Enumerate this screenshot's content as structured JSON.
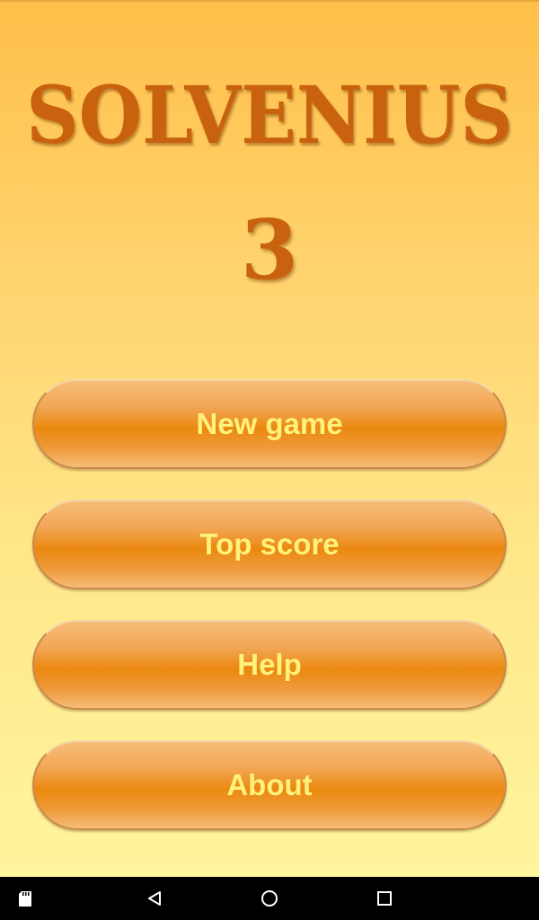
{
  "app": {
    "title": "SOLVENIUS",
    "subtitle": "3"
  },
  "menu": {
    "items": [
      {
        "label": "New game"
      },
      {
        "label": "Top score"
      },
      {
        "label": "Help"
      },
      {
        "label": "About"
      }
    ]
  },
  "navbar": {
    "icons": [
      "sd-card-icon",
      "back-icon",
      "home-icon",
      "recent-apps-icon"
    ]
  },
  "colors": {
    "title": "#c8620e",
    "button_text": "#fff27a",
    "button_base": "#ea890f",
    "background_top": "#ffbf4a",
    "background_bottom": "#fff59c"
  }
}
